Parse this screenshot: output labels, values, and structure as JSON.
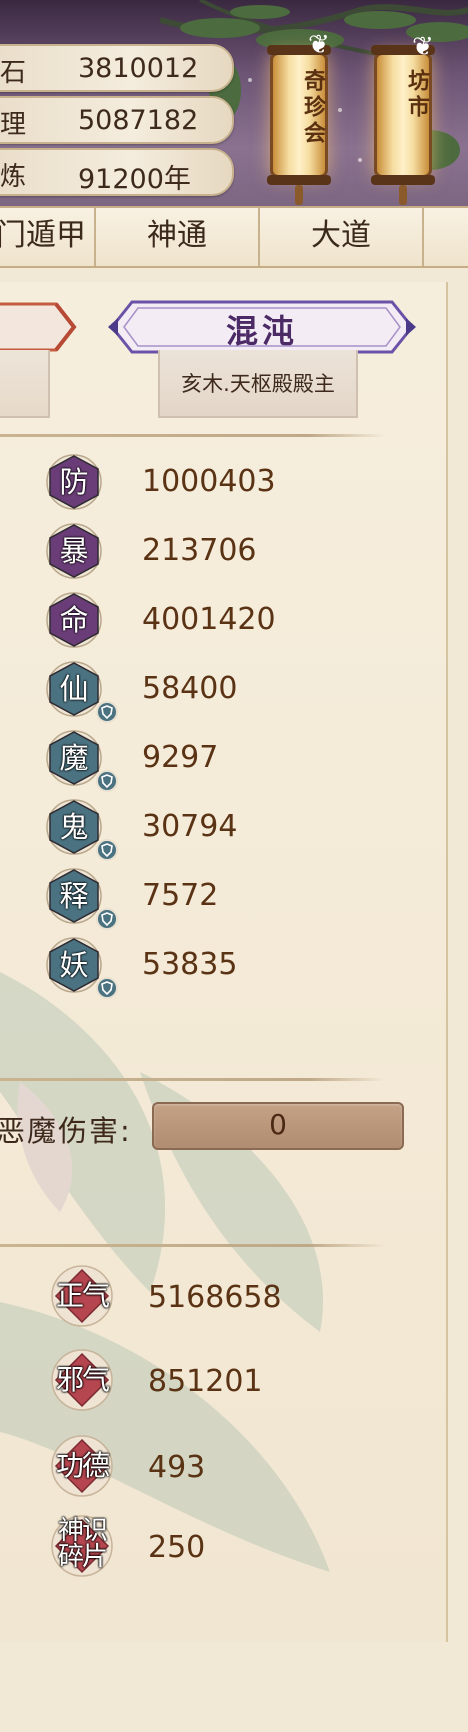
{
  "resources": [
    {
      "glyph": "石",
      "value": "3810012"
    },
    {
      "glyph": "理",
      "value": "5087182"
    },
    {
      "glyph": "炼",
      "value": "91200年"
    }
  ],
  "lanterns": [
    {
      "label": "奇珍会"
    },
    {
      "label": "坊市"
    }
  ],
  "tabs": [
    "门遁甲",
    "神通",
    "大道"
  ],
  "realm": {
    "name": "混沌",
    "subtitle": "亥木.天枢殿殿主"
  },
  "stats": [
    {
      "char": "防",
      "value": "1000403",
      "kind": "purple"
    },
    {
      "char": "暴",
      "value": "213706",
      "kind": "purple"
    },
    {
      "char": "命",
      "value": "4001420",
      "kind": "purple"
    },
    {
      "char": "仙",
      "value": "58400",
      "kind": "teal"
    },
    {
      "char": "魔",
      "value": "9297",
      "kind": "teal"
    },
    {
      "char": "鬼",
      "value": "30794",
      "kind": "teal"
    },
    {
      "char": "释",
      "value": "7572",
      "kind": "teal"
    },
    {
      "char": "妖",
      "value": "53835",
      "kind": "teal"
    }
  ],
  "demon_damage": {
    "label": "恶魔伤害:",
    "value": "0"
  },
  "qi": [
    {
      "label": "正气",
      "value": "5168658"
    },
    {
      "label": "邪气",
      "value": "851201"
    },
    {
      "label": "功德",
      "value": "493"
    },
    {
      "label": "神识碎片",
      "value": "250"
    }
  ],
  "colors": {
    "purple_hex": "#6b3d78",
    "teal_hex": "#4a7280",
    "red_hex": "#b5464f",
    "value_text": "#5a3214"
  }
}
